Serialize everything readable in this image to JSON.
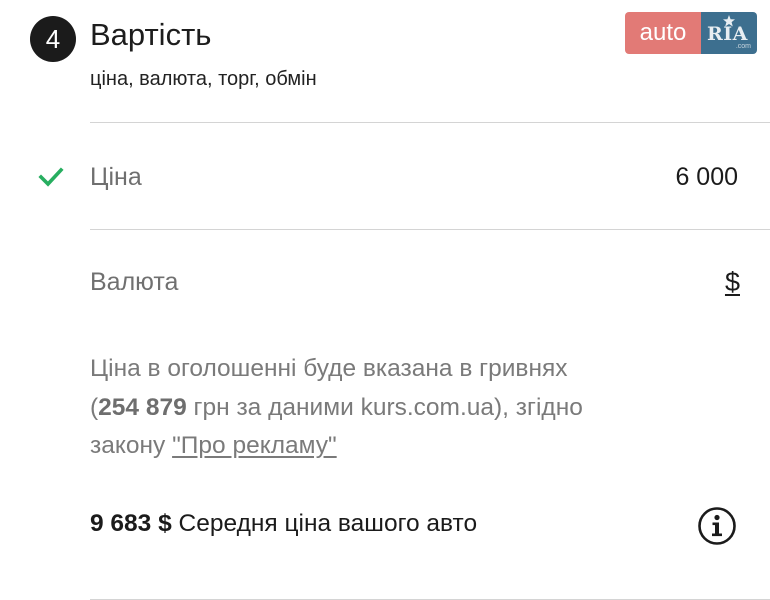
{
  "step": {
    "number": "4",
    "title": "Вартість",
    "subtitle": "ціна, валюта, торг, обмін"
  },
  "logo": {
    "auto_text": "auto",
    "ria_text": "RIA",
    "ria_domain": ".com",
    "colors": {
      "auto_bg": "#e27a76",
      "ria_bg": "#3d6f8f"
    }
  },
  "price_row": {
    "icon": "check-icon",
    "status_color": "#27ae60",
    "label": "Ціна",
    "value": "6 000"
  },
  "currency_row": {
    "label": "Валюта",
    "value": "$"
  },
  "notice": {
    "line1": "Ціна в оголошенні буде вказана в гривнях",
    "open_paren": "(",
    "uah_amount": "254 879",
    "line2_rest": " грн за даними kurs.com.ua), згідно",
    "line3_prefix": "закону ",
    "law_link": "\"Про рекламу\""
  },
  "average": {
    "amount": "9 683 $",
    "text": " Середня ціна вашого авто",
    "icon": "info-icon"
  }
}
